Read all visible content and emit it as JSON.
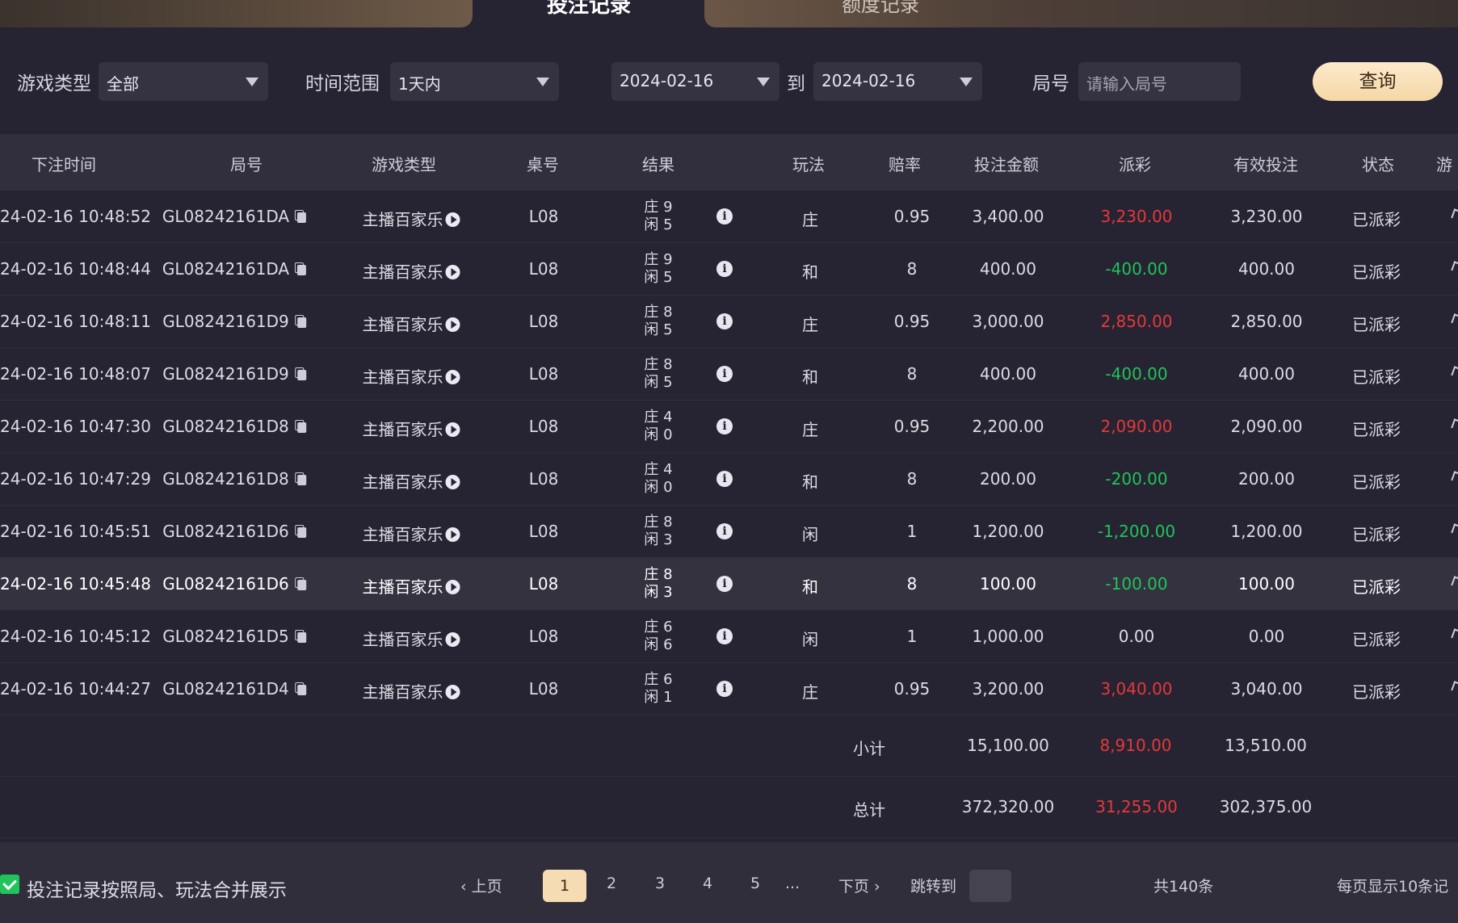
{
  "tabs": {
    "active": "投注记录",
    "other": "额度记录"
  },
  "filters": {
    "game_type_label": "游戏类型",
    "game_type_value": "全部",
    "time_range_label": "时间范围",
    "time_range_value": "1天内",
    "date_from": "2024-02-16",
    "to_label": "到",
    "date_to": "2024-02-16",
    "round_label": "局号",
    "round_placeholder": "请输入局号",
    "query_button": "查询"
  },
  "columns": [
    "下注时间",
    "局号",
    "游戏类型",
    "桌号",
    "结果",
    "玩法",
    "赔率",
    "投注金额",
    "派彩",
    "有效投注",
    "状态",
    "游"
  ],
  "rows": [
    {
      "time": "24-02-16 10:48:52",
      "round": "GL08242161DA",
      "game": "主播百家乐",
      "table": "L08",
      "r1": "庄 9",
      "r2": "闲 5",
      "bet_type": "庄",
      "odds": "0.95",
      "amount": "3,400.00",
      "payout": "3,230.00",
      "payout_sign": "pos",
      "valid": "3,230.00",
      "status": "已派彩"
    },
    {
      "time": "24-02-16 10:48:44",
      "round": "GL08242161DA",
      "game": "主播百家乐",
      "table": "L08",
      "r1": "庄 9",
      "r2": "闲 5",
      "bet_type": "和",
      "odds": "8",
      "amount": "400.00",
      "payout": "-400.00",
      "payout_sign": "neg",
      "valid": "400.00",
      "status": "已派彩"
    },
    {
      "time": "24-02-16 10:48:11",
      "round": "GL08242161D9",
      "game": "主播百家乐",
      "table": "L08",
      "r1": "庄 8",
      "r2": "闲 5",
      "bet_type": "庄",
      "odds": "0.95",
      "amount": "3,000.00",
      "payout": "2,850.00",
      "payout_sign": "pos",
      "valid": "2,850.00",
      "status": "已派彩"
    },
    {
      "time": "24-02-16 10:48:07",
      "round": "GL08242161D9",
      "game": "主播百家乐",
      "table": "L08",
      "r1": "庄 8",
      "r2": "闲 5",
      "bet_type": "和",
      "odds": "8",
      "amount": "400.00",
      "payout": "-400.00",
      "payout_sign": "neg",
      "valid": "400.00",
      "status": "已派彩"
    },
    {
      "time": "24-02-16 10:47:30",
      "round": "GL08242161D8",
      "game": "主播百家乐",
      "table": "L08",
      "r1": "庄 4",
      "r2": "闲 0",
      "bet_type": "庄",
      "odds": "0.95",
      "amount": "2,200.00",
      "payout": "2,090.00",
      "payout_sign": "pos",
      "valid": "2,090.00",
      "status": "已派彩"
    },
    {
      "time": "24-02-16 10:47:29",
      "round": "GL08242161D8",
      "game": "主播百家乐",
      "table": "L08",
      "r1": "庄 4",
      "r2": "闲 0",
      "bet_type": "和",
      "odds": "8",
      "amount": "200.00",
      "payout": "-200.00",
      "payout_sign": "neg",
      "valid": "200.00",
      "status": "已派彩"
    },
    {
      "time": "24-02-16 10:45:51",
      "round": "GL08242161D6",
      "game": "主播百家乐",
      "table": "L08",
      "r1": "庄 8",
      "r2": "闲 3",
      "bet_type": "闲",
      "odds": "1",
      "amount": "1,200.00",
      "payout": "-1,200.00",
      "payout_sign": "neg",
      "valid": "1,200.00",
      "status": "已派彩"
    },
    {
      "time": "24-02-16 10:45:48",
      "round": "GL08242161D6",
      "game": "主播百家乐",
      "table": "L08",
      "r1": "庄 8",
      "r2": "闲 3",
      "bet_type": "和",
      "odds": "8",
      "amount": "100.00",
      "payout": "-100.00",
      "payout_sign": "neg",
      "valid": "100.00",
      "status": "已派彩"
    },
    {
      "time": "24-02-16 10:45:12",
      "round": "GL08242161D5",
      "game": "主播百家乐",
      "table": "L08",
      "r1": "庄 6",
      "r2": "闲 6",
      "bet_type": "闲",
      "odds": "1",
      "amount": "1,000.00",
      "payout": "0.00",
      "payout_sign": "zero",
      "valid": "0.00",
      "status": "已派彩"
    },
    {
      "time": "24-02-16 10:44:27",
      "round": "GL08242161D4",
      "game": "主播百家乐",
      "table": "L08",
      "r1": "庄 6",
      "r2": "闲 1",
      "bet_type": "庄",
      "odds": "0.95",
      "amount": "3,200.00",
      "payout": "3,040.00",
      "payout_sign": "pos",
      "valid": "3,040.00",
      "status": "已派彩"
    }
  ],
  "subtotal": {
    "label": "小计",
    "amount": "15,100.00",
    "payout": "8,910.00",
    "valid": "13,510.00"
  },
  "total": {
    "label": "总计",
    "amount": "372,320.00",
    "payout": "31,255.00",
    "valid": "302,375.00"
  },
  "footer": {
    "merge_label": "投注记录按照局、玩法合并展示",
    "prev": "上页",
    "pages": [
      "1",
      "2",
      "3",
      "4",
      "5"
    ],
    "current_page": "1",
    "ellipsis": "...",
    "next": "下页",
    "jump_label": "跳转到",
    "total_count": "共140条",
    "per_page": "每页显示10条记"
  },
  "colors": {
    "positive": "#e5383b",
    "negative": "#20c45a",
    "accent": "#f5dcb2"
  }
}
